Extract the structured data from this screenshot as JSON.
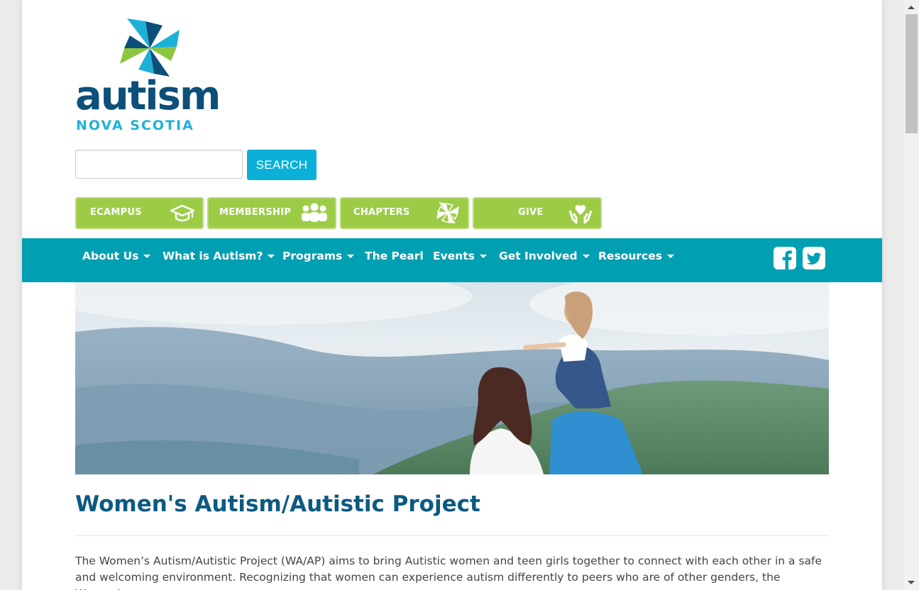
{
  "brand": {
    "logo_word": "autism",
    "logo_sub": "NOVA SCOTIA",
    "colors": {
      "navy": "#0c4f79",
      "cyan": "#1eb1d8",
      "green": "#9ccc46",
      "teal": "#00a0b2"
    }
  },
  "search": {
    "value": "",
    "placeholder": "",
    "button_label": "SEARCH"
  },
  "quick_links": [
    {
      "label": "ECAMPUS",
      "icon": "graduation-cap-icon"
    },
    {
      "label": "MEMBERSHIP",
      "icon": "people-group-icon"
    },
    {
      "label": "CHAPTERS",
      "icon": "pinwheel-icon"
    },
    {
      "label": "GIVE",
      "icon": "heart-in-hands-icon"
    }
  ],
  "nav": {
    "items": [
      {
        "label": "About Us",
        "dropdown": true
      },
      {
        "label": "What is Autism?",
        "dropdown": true
      },
      {
        "label": "Programs",
        "dropdown": true
      },
      {
        "label": "The Pearl",
        "dropdown": false
      },
      {
        "label": "Events",
        "dropdown": true
      },
      {
        "label": "Get Involved",
        "dropdown": true
      },
      {
        "label": "Resources",
        "dropdown": true
      }
    ],
    "social": [
      "facebook-icon",
      "twitter-icon"
    ]
  },
  "hero": {
    "image": "family-looking-at-mountains-photo"
  },
  "content": {
    "title": "Women's Autism/Autistic Project",
    "intro": "The Women’s Autism/Autistic Project (WA/AP) aims to bring Autistic women and teen girls together to connect with each other in a safe and welcoming environment. Recognizing that women can experience autism differently to peers who are of other genders, the Women’s"
  }
}
